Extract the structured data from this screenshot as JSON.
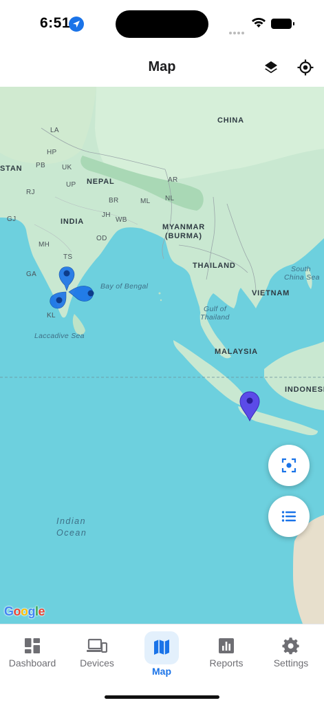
{
  "status": {
    "time": "6:51"
  },
  "header": {
    "title": "Map",
    "layers_icon": "layers-icon",
    "locate_icon": "gps-target-icon"
  },
  "map": {
    "labels": {
      "china": "CHINA",
      "nepal": "NEPAL",
      "india": "INDIA",
      "myanmar": "MYANMAR",
      "burma": "(BURMA)",
      "thailand": "THAILAND",
      "vietnam": "VIETNAM",
      "malaysia": "MALAYSIA",
      "indonesia": "INDONESIA",
      "stan": "STAN",
      "bay_of_bengal": "Bay of Bengal",
      "laccadive_sea": "Laccadive Sea",
      "south_china_sea_1": "South",
      "south_china_sea_2": "China Sea",
      "gulf_thailand_1": "Gulf of",
      "gulf_thailand_2": "Thailand",
      "indian_ocean_1": "Indian",
      "indian_ocean_2": "Ocean",
      "la": "LA",
      "hp": "HP",
      "pb": "PB",
      "uk": "UK",
      "up": "UP",
      "rj": "RJ",
      "br": "BR",
      "jh": "JH",
      "wb": "WB",
      "ml": "ML",
      "nl": "NL",
      "ar": "AR",
      "gj": "GJ",
      "mh": "MH",
      "ts": "TS",
      "od": "OD",
      "ga": "GA",
      "kl": "KL"
    },
    "attribution": "Google",
    "markers": [
      {
        "type": "cluster",
        "color": "#1a73e8"
      },
      {
        "type": "pin",
        "color": "#5b4be8"
      }
    ]
  },
  "fabs": {
    "fit_icon": "focus-frame-icon",
    "list_icon": "list-icon"
  },
  "nav": {
    "items": [
      {
        "label": "Dashboard",
        "icon": "dashboard-icon"
      },
      {
        "label": "Devices",
        "icon": "devices-icon"
      },
      {
        "label": "Map",
        "icon": "map-icon"
      },
      {
        "label": "Reports",
        "icon": "reports-icon"
      },
      {
        "label": "Settings",
        "icon": "gear-icon"
      }
    ],
    "active_color": "#1a73e8"
  }
}
